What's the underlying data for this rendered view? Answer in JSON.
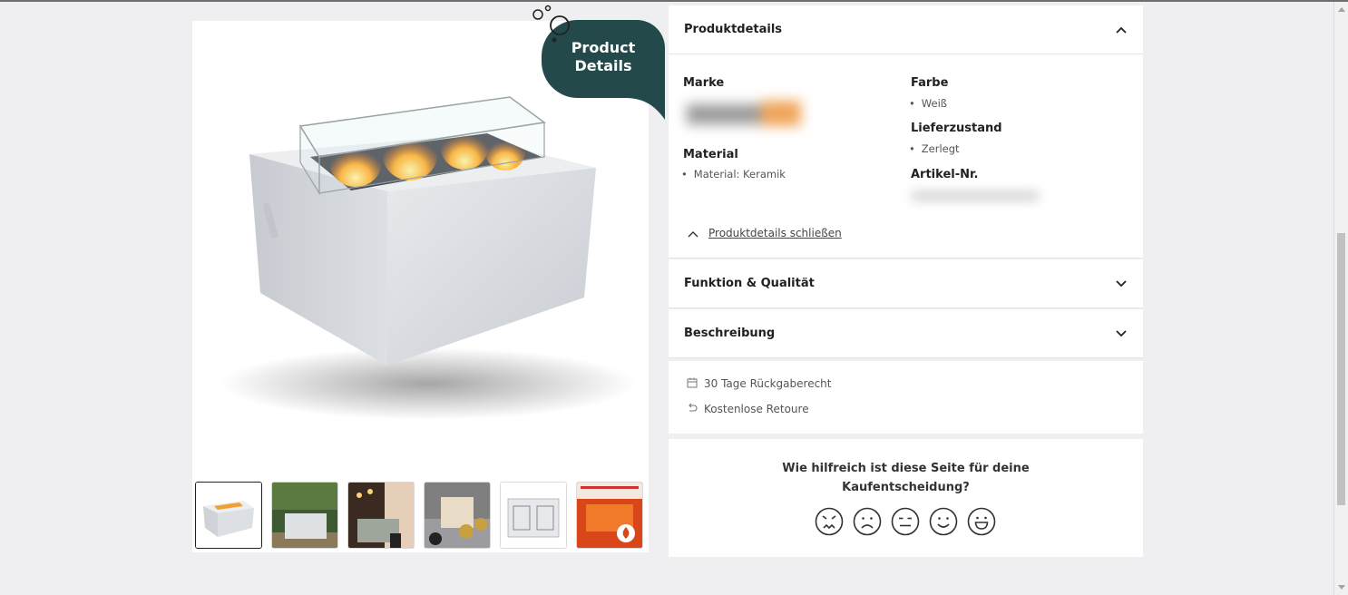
{
  "badge": {
    "line1": "Product",
    "line2": "Details"
  },
  "gallery": {
    "main_image_alt": "Feuertisch aus Keramik mit Glasaufsatz",
    "thumbnails": [
      "thumb-1",
      "thumb-2",
      "thumb-3",
      "thumb-4",
      "thumb-5",
      "thumb-6"
    ]
  },
  "product_details": {
    "title": "Produktdetails",
    "marke_label": "Marke",
    "material_label": "Material",
    "material_value": "Material: Keramik",
    "farbe_label": "Farbe",
    "farbe_value": "Weiß",
    "lieferzustand_label": "Lieferzustand",
    "lieferzustand_value": "Zerlegt",
    "artikel_label": "Artikel-Nr.",
    "close_link": "Produktdetails schließen"
  },
  "sections": {
    "funktion": "Funktion & Qualität",
    "beschreibung": "Beschreibung"
  },
  "info": {
    "return_right": "30 Tage Rückgaberecht",
    "free_return": "Kostenlose Retoure"
  },
  "feedback": {
    "question_line1": "Wie hilfreich ist diese Seite für deine",
    "question_line2": "Kaufentscheidung?",
    "faces": [
      "very-unhappy-face-icon",
      "unhappy-face-icon",
      "neutral-face-icon",
      "happy-face-icon",
      "very-happy-face-icon"
    ]
  },
  "colors": {
    "badge": "#23494a",
    "page_bg": "#efeff1"
  }
}
